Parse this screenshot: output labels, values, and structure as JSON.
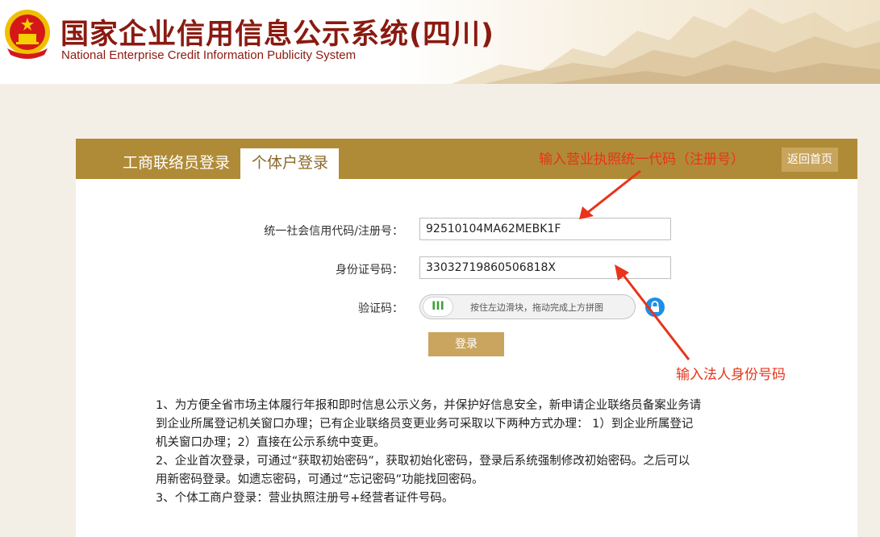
{
  "header": {
    "title_cn": "国家企业信用信息公示系统(四川)",
    "title_en": "National Enterprise Credit Information Publicity System"
  },
  "tabs": [
    {
      "label": "工商联络员登录",
      "active": false
    },
    {
      "label": "个体户登录",
      "active": true
    }
  ],
  "annotations": {
    "top_hint": "输入营业执照统一代码（注册号）",
    "bottom_hint": "输入法人身份号码",
    "color": "#e8341a"
  },
  "home_button": "返回首页",
  "form": {
    "credit_code_label": "统一社会信用代码/注册号：",
    "credit_code_value": "92510104MA62MEBK1F",
    "id_label": "身份证号码：",
    "id_value": "33032719860506818X",
    "captcha_label": "验证码：",
    "slider_knob": "III",
    "slider_text": "按住左边滑块，拖动完成上方拼图",
    "login_label": "登录"
  },
  "notes": [
    "1、为方便全省市场主体履行年报和即时信息公示义务，并保护好信息安全，新申请企业联络员备案业务请",
    "到企业所属登记机关窗口办理；已有企业联络员变更业务可采取以下两种方式办理： 1）到企业所属登记",
    "机关窗口办理；2）直接在公示系统中变更。",
    "2、企业首次登录，可通过“获取初始密码”，获取初始化密码，登录后系统强制修改初始密码。之后可以",
    "用新密码登录。如遗忘密码，可通过“忘记密码”功能找回密码。",
    "3、个体工商户登录：营业执照注册号+经营者证件号码。"
  ],
  "colors": {
    "brand_red": "#8a1a10",
    "panel_bar": "#b08b37",
    "button_gold": "#c9a55f"
  },
  "icons": {
    "emblem": "national-emblem-icon",
    "lock": "lock-icon"
  }
}
